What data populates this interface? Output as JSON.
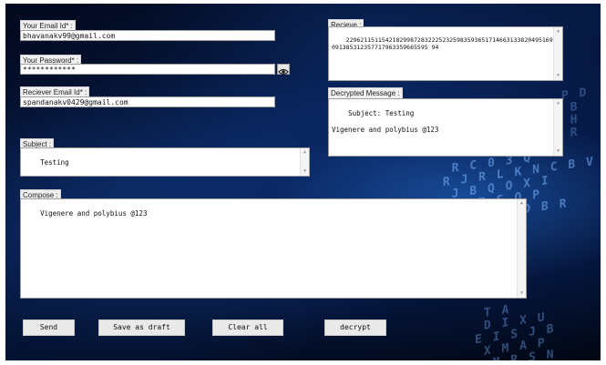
{
  "form": {
    "email_label": "Your Email Id* :",
    "email_value": "bhavanakv99@gmail.com",
    "password_label": "Your Password* :",
    "password_value": "************",
    "receiver_label": "Reciever Email Id* :",
    "receiver_value": "spandanakv0429@gmail.com",
    "subject_label": "Subject :",
    "subject_value": "Testing",
    "compose_label": "Compose :",
    "compose_value": "Vigenere and polybius @123"
  },
  "receive": {
    "label": "Recieve :",
    "value": "22962115115421829987283222523259835936517146631338204951693091385312357717963359665595 94"
  },
  "decrypted": {
    "label": "Decrypted Message :",
    "value": "Subject: Testing\n\nVigenere and polybius @123"
  },
  "buttons": {
    "send": "Send",
    "save_draft": "Save as draft",
    "clear_all": "Clear all",
    "decrypt": "decrypt"
  },
  "icons": {
    "show_password": "eye-icon"
  },
  "colors": {
    "background": "#061a44",
    "accent": "#4a8cff"
  }
}
